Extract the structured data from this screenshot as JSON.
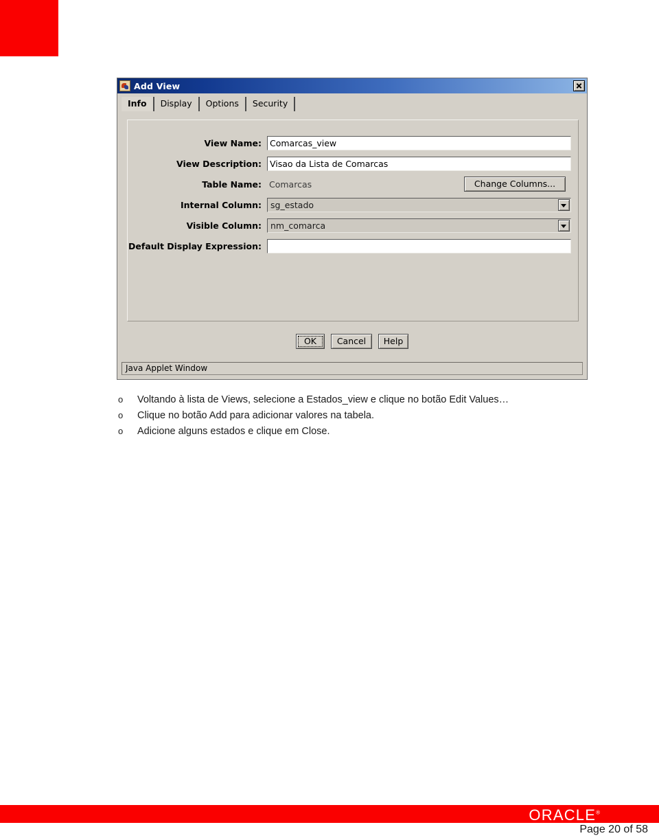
{
  "document": {
    "page_number_text": "Page 20 of 58",
    "brand": "ORACLE",
    "brand_tm": "®",
    "colors": {
      "brand_red": "#fa0000",
      "dialog_face": "#d4d0c8",
      "titlebar_start": "#0b2a70",
      "titlebar_end": "#8cb4e4"
    }
  },
  "dialog": {
    "title": "Add View",
    "icon": "java-coffee-cup-icon",
    "close_label": "×",
    "tabs": [
      {
        "label": "Info",
        "active": true
      },
      {
        "label": "Display",
        "active": false
      },
      {
        "label": "Options",
        "active": false
      },
      {
        "label": "Security",
        "active": false
      }
    ],
    "fields": {
      "view_name": {
        "label": "View Name:",
        "value": "Comarcas_view",
        "placeholder": ""
      },
      "view_description": {
        "label": "View Description:",
        "value": "Visao da Lista de Comarcas",
        "placeholder": ""
      },
      "table_name": {
        "label": "Table Name:",
        "value": "Comarcas",
        "button_label": "Change Columns..."
      },
      "internal_column": {
        "label": "Internal Column:",
        "value": "sg_estado"
      },
      "visible_column": {
        "label": "Visible Column:",
        "value": "nm_comarca"
      },
      "default_display_expression": {
        "label": "Default Display Expression:",
        "value": "",
        "placeholder": ""
      }
    },
    "buttons": {
      "ok": "OK",
      "cancel": "Cancel",
      "help": "Help"
    },
    "statusbar": "Java Applet Window"
  },
  "instructions": {
    "marker": "o",
    "items": [
      "Voltando à lista de Views, selecione a Estados_view e clique no botão Edit Values…",
      "Clique no botão Add para adicionar valores na tabela.",
      "Adicione alguns estados e clique em Close."
    ]
  }
}
